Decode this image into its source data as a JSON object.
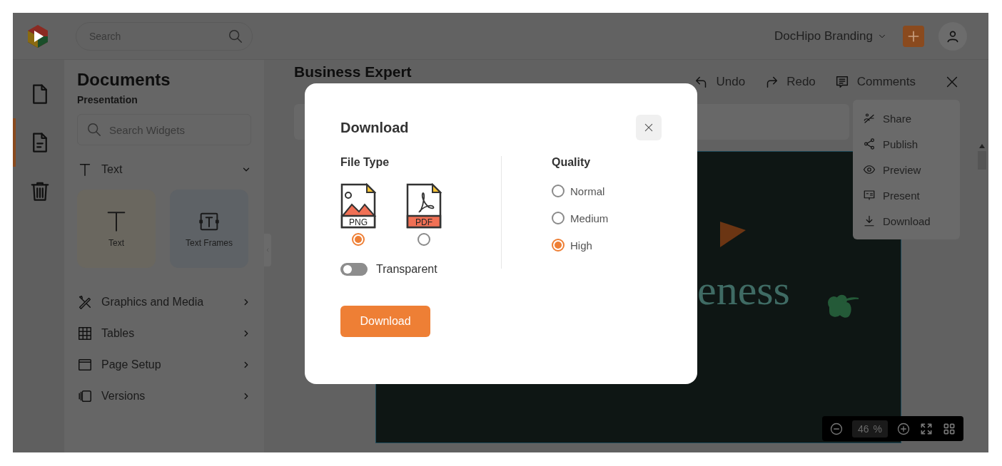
{
  "topbar": {
    "search_placeholder": "Search",
    "workspace": "DocHipo Branding"
  },
  "rail": [
    {
      "kind": "document",
      "selected": false
    },
    {
      "kind": "page",
      "selected": true
    },
    {
      "kind": "trash",
      "selected": false
    }
  ],
  "sidebar": {
    "title": "Documents",
    "subtitle": "Presentation",
    "search_placeholder": "Search Widgets",
    "sections": [
      {
        "label": "Text",
        "kind": "text",
        "expanded": true
      },
      {
        "label": "Graphics and Media",
        "kind": "graphics",
        "expanded": false
      },
      {
        "label": "Tables",
        "kind": "tables",
        "expanded": false
      },
      {
        "label": "Page Setup",
        "kind": "page",
        "expanded": false
      },
      {
        "label": "Versions",
        "kind": "versions",
        "expanded": false
      }
    ],
    "widgets": [
      {
        "label": "Text",
        "kind": "text"
      },
      {
        "label": "Text Frames",
        "kind": "frame"
      }
    ]
  },
  "editor": {
    "title": "Business Expert",
    "actions": [
      {
        "label": "Undo",
        "kind": "undo"
      },
      {
        "label": "Redo",
        "kind": "redo"
      },
      {
        "label": "Comments",
        "kind": "comments"
      }
    ],
    "menu": [
      {
        "label": "Share",
        "kind": "share"
      },
      {
        "label": "Publish",
        "kind": "publish"
      },
      {
        "label": "Preview",
        "kind": "preview"
      },
      {
        "label": "Present",
        "kind": "present"
      },
      {
        "label": "Download",
        "kind": "download"
      }
    ],
    "slide_text": "eness",
    "zoom": "46",
    "zoom_unit": "%"
  },
  "dialog": {
    "title": "Download",
    "file_type_label": "File Type",
    "file_types": [
      {
        "label": "PNG",
        "kind": "png",
        "selected": true
      },
      {
        "label": "PDF",
        "kind": "pdf",
        "selected": false
      }
    ],
    "transparent": {
      "label": "Transparent",
      "on": false
    },
    "quality_label": "Quality",
    "qualities": [
      {
        "label": "Normal",
        "selected": false
      },
      {
        "label": "Medium",
        "selected": false
      },
      {
        "label": "High",
        "selected": true
      }
    ],
    "button": "Download"
  }
}
